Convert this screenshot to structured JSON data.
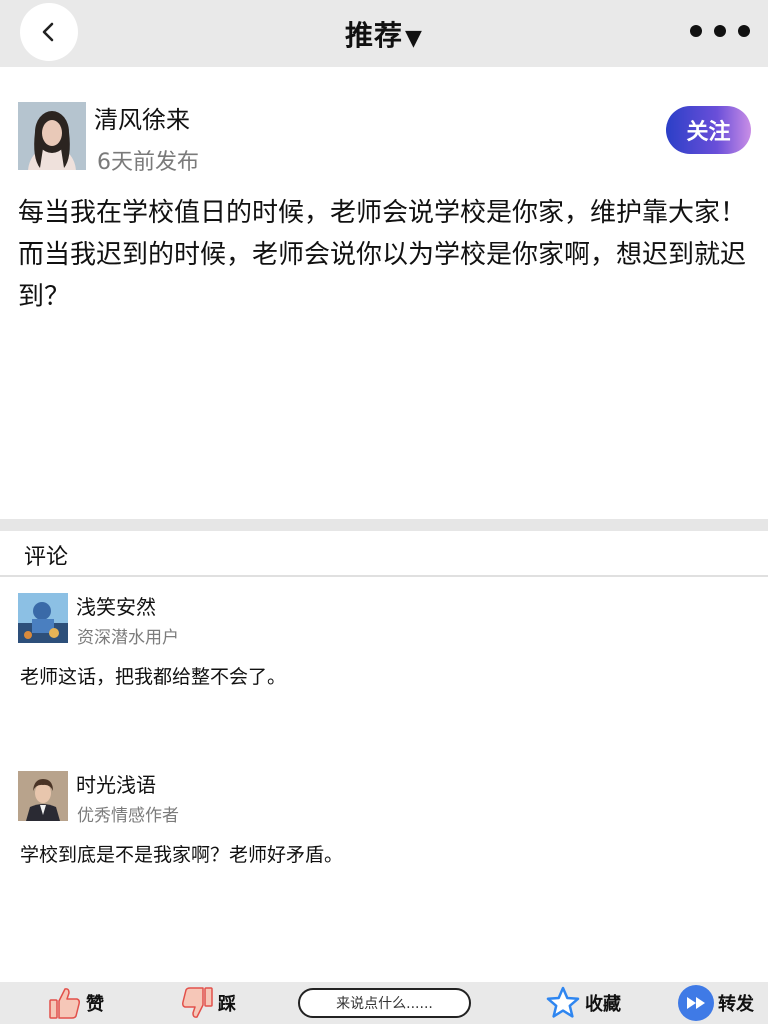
{
  "header": {
    "title": "推荐",
    "title_caret": "▼"
  },
  "post": {
    "author": "清风徐来",
    "time": "6天前发布",
    "follow_label": "关注",
    "body": "每当我在学校值日的时候，老师会说学校是你家，维护靠大家！而当我迟到的时候，老师会说你以为学校是你家啊，想迟到就迟到？"
  },
  "comments": {
    "title": "评论",
    "items": [
      {
        "name": "浅笑安然",
        "role": "资深潜水用户",
        "text": "老师这话，把我都给整不会了。"
      },
      {
        "name": "时光浅语",
        "role": "优秀情感作者",
        "text": "学校到底是不是我家啊？老师好矛盾。"
      }
    ]
  },
  "bottom_bar": {
    "like_label": "赞",
    "dislike_label": "踩",
    "input_placeholder": "来说点什么......",
    "favorite_label": "收藏",
    "share_label": "转发"
  },
  "colors": {
    "follow_gradient_start": "#2b3fc7",
    "follow_gradient_end": "#c98ee6",
    "share_blue": "#3f7ae6",
    "star_blue": "#2f86f0",
    "thumb_red": "#e2504a"
  }
}
